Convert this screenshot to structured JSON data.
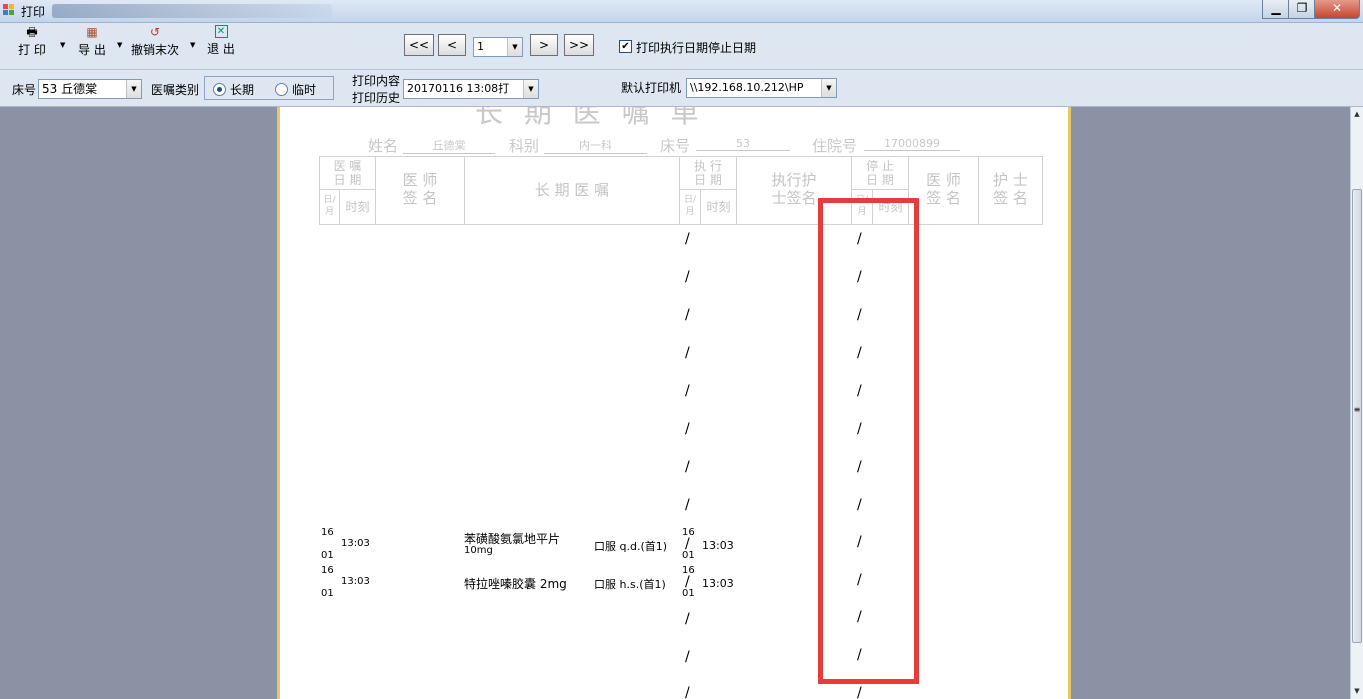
{
  "window": {
    "title": "打印",
    "controls": {
      "minimize": "▁",
      "maximize": "❐",
      "close": "✕"
    }
  },
  "toolbar": {
    "print_label": "打 印",
    "export_label": "导 出",
    "undo_last_label": "撤销末次",
    "exit_label": "退 出",
    "first_page": "<<",
    "prev_page": "<",
    "page_value": "1",
    "next_page": ">",
    "last_page": ">>",
    "print_dates_checked": true,
    "print_dates_label": "打印执行日期停止日期"
  },
  "filter": {
    "bed_label": "床号",
    "bed_value": "53  丘德棠",
    "order_type_label": "医嘱类别",
    "long_term_label": "长期",
    "temporary_label": "临时",
    "long_term_selected": true,
    "print_content_label": "打印内容",
    "print_history_label": "打印历史",
    "history_value": "20170116  13:08打",
    "default_printer_label": "默认打印机",
    "printer_value": "\\\\192.168.10.212\\HP"
  },
  "sheet": {
    "title": "长  期  医  嘱  单",
    "name_label": "姓名",
    "name_value": "丘德棠",
    "dept_label": "科别",
    "dept_value": "内一科",
    "bed_label": "床号",
    "bed_value": "53",
    "admission_label": "住院号",
    "admission_value": "17000899",
    "headers": {
      "order_date": "医 嘱\n日 期",
      "month_day": "日/月",
      "time": "时刻",
      "doctor_sign": "医 师\n签 名",
      "long_term_order": "长 期 医 嘱",
      "exec_date": "执 行\n日 期",
      "exec_month_day": "日/月",
      "exec_time": "时刻",
      "exec_nurse": "执行护\n士签名",
      "stop_date": "停 止\n日 期",
      "stop_month_day": "日/月",
      "stop_time": "时刻",
      "stop_doctor": "医 师\n签 名",
      "stop_nurse": "护 士\n签 名"
    },
    "orders": [
      {
        "day": "16",
        "month": "01",
        "time": "13:03",
        "drug": "苯磺酸氨氯地平片",
        "dose": "10mg",
        "usage": "口服 q.d.(首1)",
        "exec_day": "16",
        "exec_month": "01",
        "exec_time": "13:03"
      },
      {
        "day": "16",
        "month": "01",
        "time": "13:03",
        "drug": "特拉唑嗪胶囊  2mg",
        "dose": "",
        "usage": "口服 h.s.(首1)",
        "exec_day": "16",
        "exec_month": "01",
        "exec_time": "13:03"
      }
    ],
    "slash": "/"
  },
  "scrollbar": {
    "up": "▲",
    "down": "▼",
    "grip": "≡"
  },
  "colors": {
    "highlight": "#e83b3b",
    "paper_border": "#e8c766"
  }
}
